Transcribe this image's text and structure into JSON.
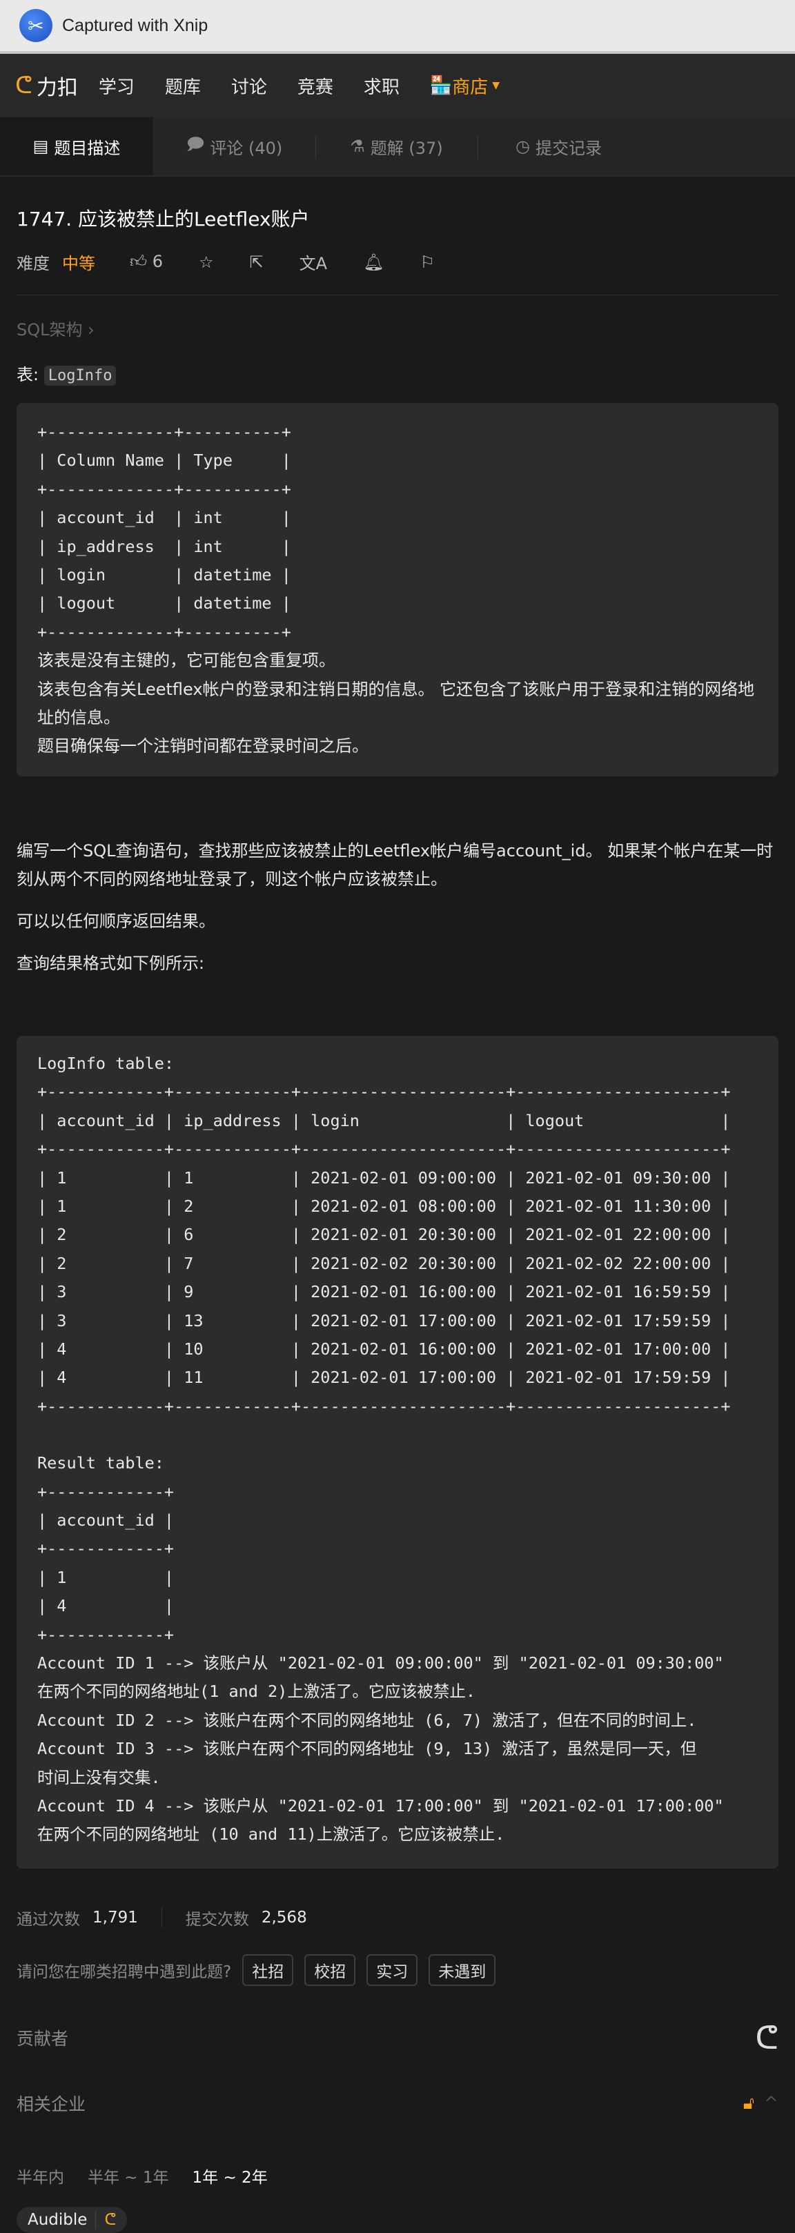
{
  "capture_bar": {
    "label": "Captured with Xnip"
  },
  "nav": {
    "brand": "力扣",
    "items": [
      "学习",
      "题库",
      "讨论",
      "竞赛",
      "求职"
    ],
    "shop": "商店"
  },
  "tabs": [
    {
      "label": "题目描述",
      "icon": "description-icon",
      "active": true
    },
    {
      "label": "评论 (40)",
      "icon": "comment-icon"
    },
    {
      "label": "题解 (37)",
      "icon": "flask-icon"
    },
    {
      "label": "提交记录",
      "icon": "clock-icon"
    }
  ],
  "problem": {
    "title": "1747. 应该被禁止的Leetflex账户",
    "difficulty_label": "难度",
    "difficulty": "中等",
    "likes": "6",
    "breadcrumb": "SQL架构 ›",
    "table_label": "表: ",
    "table_name": "LogInfo"
  },
  "schema": {
    "lines": [
      "+-------------+----------+",
      "| Column Name | Type     |",
      "+-------------+----------+",
      "| account_id  | int      |",
      "| ip_address  | int      |",
      "| login       | datetime |",
      "| logout      | datetime |",
      "+-------------+----------+"
    ],
    "notes": [
      "该表是没有主键的，它可能包含重复项。",
      "该表包含有关Leetflex帐户的登录和注销日期的信息。 它还包含了该账户用于登录和注销的网络地址的信息。",
      "题目确保每一个注销时间都在登录时间之后。"
    ]
  },
  "description": [
    "编写一个SQL查询语句，查找那些应该被禁止的Leetflex帐户编号account_id。 如果某个帐户在某一时刻从两个不同的网络地址登录了，则这个帐户应该被禁止。",
    "可以以任何顺序返回结果。",
    "查询结果格式如下例所示:"
  ],
  "example": {
    "lines": [
      "LogInfo table:",
      "+------------+------------+---------------------+---------------------+",
      "| account_id | ip_address | login               | logout              |",
      "+------------+------------+---------------------+---------------------+",
      "| 1          | 1          | 2021-02-01 09:00:00 | 2021-02-01 09:30:00 |",
      "| 1          | 2          | 2021-02-01 08:00:00 | 2021-02-01 11:30:00 |",
      "| 2          | 6          | 2021-02-01 20:30:00 | 2021-02-01 22:00:00 |",
      "| 2          | 7          | 2021-02-02 20:30:00 | 2021-02-02 22:00:00 |",
      "| 3          | 9          | 2021-02-01 16:00:00 | 2021-02-01 16:59:59 |",
      "| 3          | 13         | 2021-02-01 17:00:00 | 2021-02-01 17:59:59 |",
      "| 4          | 10         | 2021-02-01 16:00:00 | 2021-02-01 17:00:00 |",
      "| 4          | 11         | 2021-02-01 17:00:00 | 2021-02-01 17:59:59 |",
      "+------------+------------+---------------------+---------------------+",
      "",
      "Result table:",
      "+------------+",
      "| account_id |",
      "+------------+",
      "| 1          |",
      "| 4          |",
      "+------------+",
      "Account ID 1 --> 该账户从 \"2021-02-01 09:00:00\" 到 \"2021-02-01 09:30:00\"",
      "在两个不同的网络地址(1 and 2)上激活了。它应该被禁止.",
      "Account ID 2 --> 该账户在两个不同的网络地址 (6, 7) 激活了，但在不同的时间上.",
      "Account ID 3 --> 该账户在两个不同的网络地址 (9, 13) 激活了，虽然是同一天，但",
      "时间上没有交集.",
      "Account ID 4 --> 该账户从 \"2021-02-01 17:00:00\" 到 \"2021-02-01 17:00:00\"",
      "在两个不同的网络地址 (10 and 11)上激活了。它应该被禁止."
    ]
  },
  "stats": {
    "accepted_label": "通过次数",
    "accepted": "1,791",
    "submitted_label": "提交次数",
    "submitted": "2,568"
  },
  "recruit": {
    "question": "请问您在哪类招聘中遇到此题?",
    "options": [
      "社招",
      "校招",
      "实习",
      "未遇到"
    ]
  },
  "contributors": {
    "label": "贡献者"
  },
  "companies": {
    "label": "相关企业",
    "periods": [
      "半年内",
      "半年 ~ 1年",
      "1年 ~ 2年"
    ],
    "active_period": "1年 ~ 2年",
    "items": [
      "Audible"
    ]
  },
  "colors": {
    "accent": "#ffa116",
    "background": "#1a1a1b",
    "code_block": "#2c2c2e"
  }
}
